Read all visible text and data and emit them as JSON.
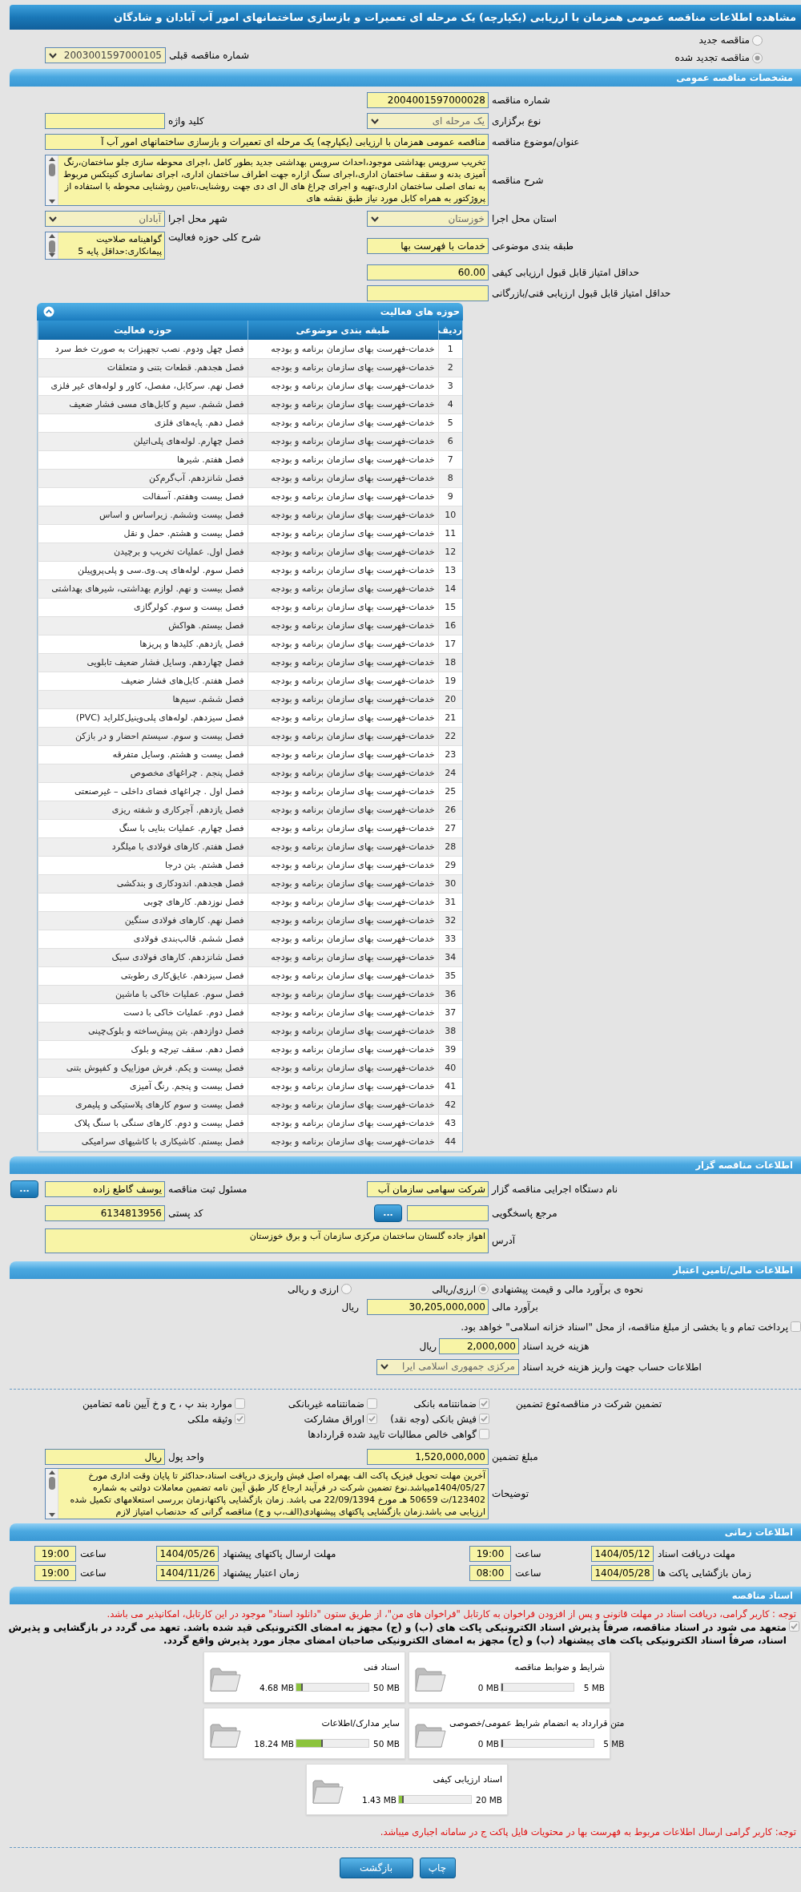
{
  "title": "مشاهده اطلاعات مناقصه عمومی همزمان با ارزیابی (یکپارچه) یک مرحله ای تعمیرات و بازسازی ساختمانهای امور آب آبادان و شادگان",
  "tender_type": [
    {
      "label": "مناقصه جدید",
      "selected": false
    },
    {
      "label": "مناقصه تجدید شده",
      "selected": true
    }
  ],
  "previous_tender": {
    "label": "شماره مناقصه قبلی",
    "value": "2003001597000105"
  },
  "general": {
    "header": "مشخصات مناقصه عمومی",
    "rows": [
      [
        {
          "kind": "text",
          "label": "شماره مناقصه",
          "value": "2004001597000028"
        }
      ],
      [
        {
          "kind": "select",
          "label": "نوع برگزاری",
          "value": "یک مرحله ای"
        },
        {
          "kind": "text",
          "label": "کلید واژه"
        }
      ],
      [
        {
          "kind": "long_text",
          "label": "عنوان/موضوع مناقصه",
          "value": "مناقصه عمومی همزمان با ارزیابی (یکپارچه) یک مرحله ای تعمیرات و بازسازی ساختمانهای امور آب آ"
        }
      ],
      [
        {
          "kind": "memo",
          "label": "شرح مناقصه",
          "value": "تخریب سرویس بهداشتی موجود،احداث سرویس بهداشتی جدید بطور کامل ،اجرای محوطه سازی جلو ساختمان،رنگ آمیزی بدنه و سقف ساختمان اداری،اجرای سنگ ازاره جهت اطراف ساختمان اداری، اجرای نماسازی کنیتکس مربوط به نمای اصلی ساختمان اداری،تهیه و اجرای چراغ های ال ای دی جهت روشنایی،تامین روشنایی محوطه با استفاده از پروژکتور به همراه کابل مورد نیاز طبق نقشه های"
        }
      ],
      [
        {
          "kind": "select",
          "label": "استان محل اجرا",
          "value": "خوزستان"
        },
        {
          "kind": "select",
          "label": "شهر محل اجرا",
          "value": "آبادان"
        }
      ],
      [
        {
          "kind": "text",
          "label": "طبقه بندی موضوعی",
          "value": "خدمات با فهرست بها"
        },
        {
          "kind": "memo_small",
          "label": "شرح کلی حوزه فعالیت",
          "value": "گواهینامه صلاحیت پیمانکاری:حداقل پایه 5"
        }
      ],
      [
        {
          "kind": "text",
          "label": "حداقل امتیاز قابل قبول ارزیابی کیفی",
          "value": "60.00"
        }
      ],
      [
        {
          "kind": "text",
          "label": "حداقل امتیاز قابل قبول ارزیابی فنی/بازرگانی"
        }
      ]
    ]
  },
  "activities": {
    "header": "حوزه های فعالیت",
    "columns": [
      "ردیف",
      "طبقه بندی موضوعی",
      "حوزه فعالیت"
    ],
    "rows": [
      [
        "1",
        "خدمات-فهرست بهای سازمان برنامه و بودجه",
        "فصل چهل ودوم. نصب تجهیزات به صورت خط سرد"
      ],
      [
        "2",
        "خدمات-فهرست بهای سازمان برنامه و بودجه",
        "فصل هجدهم. قطعات بتنی و متعلقات"
      ],
      [
        "3",
        "خدمات-فهرست بهای سازمان برنامه و بودجه",
        "فصل نهم. سرکابل، مفصل، کاور و لوله‌های غیر فلزی"
      ],
      [
        "4",
        "خدمات-فهرست بهای سازمان برنامه و بودجه",
        "فصل ششم. سیم و کابل‌های مسی فشار ضعیف"
      ],
      [
        "5",
        "خدمات-فهرست بهای سازمان برنامه و بودجه",
        "فصل دهم. پایه‌های فلزی"
      ],
      [
        "6",
        "خدمات-فهرست بهای سازمان برنامه و بودجه",
        "فصل چهارم. لوله‌های پلی‌اتیلن"
      ],
      [
        "7",
        "خدمات-فهرست بهای سازمان برنامه و بودجه",
        "فصل هفتم. شیرها"
      ],
      [
        "8",
        "خدمات-فهرست بهای سازمان برنامه و بودجه",
        "فصل شانزدهم. آب‌گرم‌کن"
      ],
      [
        "9",
        "خدمات-فهرست بهای سازمان برنامه و بودجه",
        "فصل بیست وهفتم. آسفالت"
      ],
      [
        "10",
        "خدمات-فهرست بهای سازمان برنامه و بودجه",
        "فصل بیست وششم. زیراساس و اساس"
      ],
      [
        "11",
        "خدمات-فهرست بهای سازمان برنامه و بودجه",
        "فصل بیست و هشتم. حمل و نقل"
      ],
      [
        "12",
        "خدمات-فهرست بهای سازمان برنامه و بودجه",
        "فصل اول. عملیات تخریب و برچیدن"
      ],
      [
        "13",
        "خدمات-فهرست بهای سازمان برنامه و بودجه",
        "فصل سوم. لوله‌های پی.وی.سی و پلی‌پروپیلن"
      ],
      [
        "14",
        "خدمات-فهرست بهای سازمان برنامه و بودجه",
        "فصل بیست و نهم. لوازم بهداشتی، شیرهای بهداشتی"
      ],
      [
        "15",
        "خدمات-فهرست بهای سازمان برنامه و بودجه",
        "فصل بیست و سوم. کولرگازی"
      ],
      [
        "16",
        "خدمات-فهرست بهای سازمان برنامه و بودجه",
        "فصل بیستم. هواکش"
      ],
      [
        "17",
        "خدمات-فهرست بهای سازمان برنامه و بودجه",
        "فصل یازدهم. کلیدها و پریزها"
      ],
      [
        "18",
        "خدمات-فهرست بهای سازمان برنامه و بودجه",
        "فصل چهاردهم. وسایل فشار ضعیف تابلویی"
      ],
      [
        "19",
        "خدمات-فهرست بهای سازمان برنامه و بودجه",
        "فصل هفتم. کابل‌های فشار ضعیف"
      ],
      [
        "20",
        "خدمات-فهرست بهای سازمان برنامه و بودجه",
        "فصل ششم. سیم‌ها"
      ],
      [
        "21",
        "خدمات-فهرست بهای سازمان برنامه و بودجه",
        "فصل سیزدهم. لوله‌های پلی‌وینیل‌کلراید (PVC)"
      ],
      [
        "22",
        "خدمات-فهرست بهای سازمان برنامه و بودجه",
        "فصل بیست و سوم. سیستم احضار و در بازکن"
      ],
      [
        "23",
        "خدمات-فهرست بهای سازمان برنامه و بودجه",
        "فصل بیست و هشتم. وسایل متفرقه"
      ],
      [
        "24",
        "خدمات-فهرست بهای سازمان برنامه و بودجه",
        "فصل پنجم . چراغهای مخصوص"
      ],
      [
        "25",
        "خدمات-فهرست بهای سازمان برنامه و بودجه",
        "فصل اول . چراغهای فضای داخلی – غیرصنعتی"
      ],
      [
        "26",
        "خدمات-فهرست بهای سازمان برنامه و بودجه",
        "فصل یازدهم. آجرکاری و شفته ریزی"
      ],
      [
        "27",
        "خدمات-فهرست بهای سازمان برنامه و بودجه",
        "فصل چهارم. عملیات بنایی با سنگ"
      ],
      [
        "28",
        "خدمات-فهرست بهای سازمان برنامه و بودجه",
        "فصل هفتم. کارهای فولادی با میلگرد"
      ],
      [
        "29",
        "خدمات-فهرست بهای سازمان برنامه و بودجه",
        "فصل هشتم. بتن درجا"
      ],
      [
        "30",
        "خدمات-فهرست بهای سازمان برنامه و بودجه",
        "فصل هجدهم. اندودکاری و بندکشی"
      ],
      [
        "31",
        "خدمات-فهرست بهای سازمان برنامه و بودجه",
        "فصل نوزدهم. کارهای چوبی"
      ],
      [
        "32",
        "خدمات-فهرست بهای سازمان برنامه و بودجه",
        "فصل نهم. کارهای فولادی سنگین"
      ],
      [
        "33",
        "خدمات-فهرست بهای سازمان برنامه و بودجه",
        "فصل ششم. قالب‌بندی فولادی"
      ],
      [
        "34",
        "خدمات-فهرست بهای سازمان برنامه و بودجه",
        "فصل شانزدهم. کارهای فولادی سبک"
      ],
      [
        "35",
        "خدمات-فهرست بهای سازمان برنامه و بودجه",
        "فصل سیزدهم. عایق‌کاری رطوبتی"
      ],
      [
        "36",
        "خدمات-فهرست بهای سازمان برنامه و بودجه",
        "فصل سوم. عملیات خاکی با ماشین"
      ],
      [
        "37",
        "خدمات-فهرست بهای سازمان برنامه و بودجه",
        "فصل دوم. عملیات خاکی با دست"
      ],
      [
        "38",
        "خدمات-فهرست بهای سازمان برنامه و بودجه",
        "فصل دوازدهم. بتن پیش‌ساخته و بلوک‌چینی"
      ],
      [
        "39",
        "خدمات-فهرست بهای سازمان برنامه و بودجه",
        "فصل دهم. سقف تیرچه و بلوک"
      ],
      [
        "40",
        "خدمات-فهرست بهای سازمان برنامه و بودجه",
        "فصل بیست و یکم. فرش موزاییک و کفپوش بتنی"
      ],
      [
        "41",
        "خدمات-فهرست بهای سازمان برنامه و بودجه",
        "فصل بیست و پنجم. رنگ آمیزی"
      ],
      [
        "42",
        "خدمات-فهرست بهای سازمان برنامه و بودجه",
        "فصل بیست و سوم کارهای پلاستیکی و پلیمری"
      ],
      [
        "43",
        "خدمات-فهرست بهای سازمان برنامه و بودجه",
        "فصل بیست و دوم. کارهای سنگی با سنگ پلاک"
      ],
      [
        "44",
        "خدمات-فهرست بهای سازمان برنامه و بودجه",
        "فصل بیستم. کاشیکاری با کاشیهای سرامیکی"
      ]
    ]
  },
  "organizer": {
    "header": "اطلاعات مناقصه گزار",
    "rows": [
      [
        {
          "kind": "text",
          "label": "نام دستگاه اجرایی مناقصه گزار",
          "value": "شرکت سهامی سازمان آب"
        },
        {
          "kind": "text",
          "label": "مسئول ثبت مناقصه",
          "value": "یوسف گاطع زاده",
          "button": "..."
        }
      ],
      [
        {
          "kind": "text",
          "label": "مرجع پاسخگویی",
          "button": "..."
        },
        {
          "kind": "text",
          "label": "کد پستی",
          "value": "6134813956"
        }
      ],
      [
        {
          "kind": "memo",
          "label": "آدرس",
          "value": "اهواز جاده گلستان ساختمان مرکزی سازمان آب و برق خوزستان"
        }
      ]
    ]
  },
  "financial": {
    "header": "اطلاعات مالی/تامین اعتبار",
    "method": {
      "label": "نحوه ی برآورد مالی و قیمت پیشنهادی",
      "options": [
        {
          "label": "ارزی/ریالی",
          "selected": true
        },
        {
          "label": "ارزی و ریالی",
          "selected": false
        }
      ]
    },
    "estimate": {
      "label": "برآورد مالی",
      "value": "30,205,000,000",
      "unit": "ریال"
    },
    "treasury": {
      "label": "پرداخت تمام و یا بخشی از مبلغ مناقصه، از محل \"اسناد خزانه اسلامی\" خواهد بود.",
      "checked": false
    },
    "fee": {
      "label": "هزینه خرید اسناد",
      "value": "2,000,000",
      "unit": "ریال"
    },
    "account": {
      "label": "اطلاعات حساب جهت واریز هزینه خرید اسناد",
      "value": "مرکزی جمهوری اسلامی ایرا"
    },
    "guarantee": {
      "label": "تضمین شرکت در مناقصه:",
      "type_label": "نوع تضمین",
      "columns": [
        [
          {
            "label": "ضمانتنامه بانکی",
            "checked": true
          },
          {
            "label": "فیش بانکی (وجه نقد)",
            "checked": true
          },
          {
            "label": "گواهی خالص مطالبات تایید شده قراردادها",
            "checked": false
          }
        ],
        [
          {
            "label": "ضمانتنامه غیربانکی",
            "checked": false
          },
          {
            "label": "اوراق مشارکت",
            "checked": true
          }
        ],
        [
          {
            "label": "موارد بند پ ، ح و خ آیین نامه تضامین",
            "checked": false
          },
          {
            "label": "وثیقه ملکی",
            "checked": true
          }
        ]
      ]
    },
    "rows": [
      [
        {
          "kind": "text",
          "label": "مبلغ تضمین",
          "value": "1,520,000,000"
        },
        {
          "kind": "text",
          "label": "واحد پول",
          "value": "ریال"
        }
      ],
      [
        {
          "kind": "memo",
          "label": "توضیحات",
          "value": "آخرین مهلت تحویل فیزیک پاکت الف بهمراه اصل فیش واریزی دریافت اسناد،حداکثر تا پایان وقت اداری مورخ 1404/05/27میباشد.نوع تضمین شرکت در فرآیند ارجاع کار طبق آیین نامه تضمین معاملات دولتی به شماره 123402/ت 50659 هـ مورخ 22/09/1394 می باشد. زمان بازگشایی پاکتها،زمان بررسی استعلامهای تکمیل شده ارزیابی می باشد.زمان بازگشایی پاکتهای پیشنهادی(الف،ب و ج) مناقصه گرانی که حدنصاب امتیاز لازم"
        }
      ]
    ]
  },
  "timing": {
    "header": "اطلاعات زمانی",
    "items": [
      {
        "label": "مهلت دریافت اسناد",
        "date": "1404/05/12",
        "time_label": "ساعت",
        "time": "19:00"
      },
      {
        "label": "مهلت ارسال پاکتهای پیشنهاد",
        "date": "1404/05/26",
        "time_label": "ساعت",
        "time": "19:00"
      },
      {
        "label": "زمان بازگشایی پاکت ها",
        "date": "1404/05/28",
        "time_label": "ساعت",
        "time": "08:00"
      },
      {
        "label": "زمان اعتبار پیشنهاد",
        "date": "1404/11/26",
        "time_label": "ساعت",
        "time": "19:00"
      }
    ]
  },
  "documents": {
    "header": "اسناد مناقصه",
    "notice": "توجه : کاربر گرامی، دریافت اسناد در مهلت قانونی و پس از افزودن فراخوان به کارتابل \"فراخوان های من\"، از طریق ستون \"دانلود اسناد\" موجود در این کارتابل، امکانپذیر می باشد.",
    "commitment": {
      "label": "متعهد می شود در اسناد مناقصه، صرفاً پذیرش اسناد الکترونیکی پاکت های (ب) و (ج) مجهز به امضای الکترونیکی قید شده باشد. تعهد می گردد در بازگشایی و پذیرش اسناد، صرفاً اسناد الکترونیکی پاکت های پیشنهاد (ب) و (ج) مجهز به امضای الکترونیکی صاحبان امضای مجاز مورد پذیرش واقع گردد.",
      "checked": true
    },
    "cards": [
      {
        "title": "شرایط و ضوابط مناقصه",
        "max": "5 MB",
        "used": "0 MB",
        "level": 0
      },
      {
        "title": "اسناد فنی",
        "max": "50 MB",
        "used": "4.68 MB",
        "level": 0.094
      },
      {
        "title": "متن قرارداد به انضمام شرایط عمومی/خصوصی",
        "max": "5 MB",
        "used": "0 MB",
        "level": 0
      },
      {
        "title": "سایر مدارک/اطلاعات",
        "max": "50 MB",
        "used": "18.24 MB",
        "level": 0.365
      },
      {
        "title": "اسناد ارزیابی کیفی",
        "max": "20 MB",
        "used": "1.43 MB",
        "level": 0.072
      }
    ],
    "footer_note": "توجه: کاربر گرامی ارسال اطلاعات مربوط به فهرست بها در محتویات فایل پاکت ج در سامانه اجباری میباشد."
  },
  "buttons": [
    "چاپ",
    "بازگشت"
  ]
}
